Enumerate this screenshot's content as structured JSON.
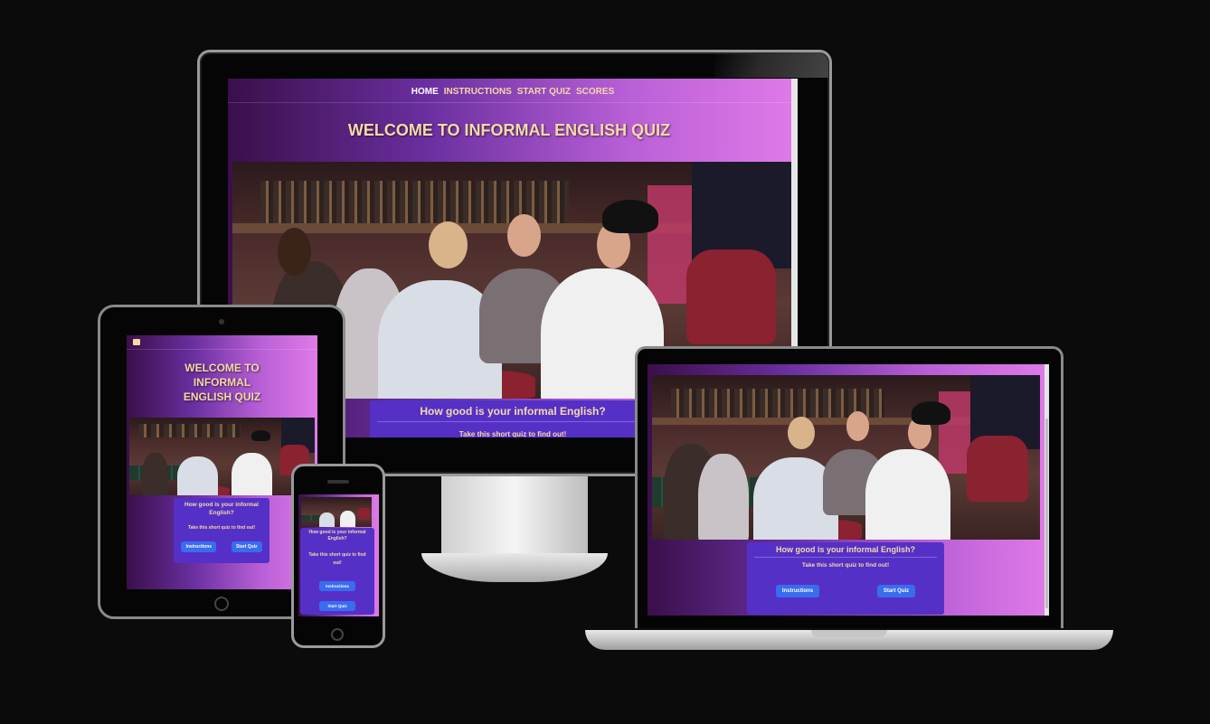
{
  "nav": {
    "home": "HOME",
    "instructions": "INSTRUCTIONS",
    "start_quiz": "START QUIZ",
    "scores": "SCORES"
  },
  "header": {
    "title": "WELCOME TO INFORMAL ENGLISH QUIZ",
    "title_tablet_line1": "WELCOME TO",
    "title_tablet_line2": "INFORMAL",
    "title_tablet_line3": "ENGLISH QUIZ"
  },
  "intro": {
    "question": "How good is your informal English?",
    "question_line1": "How good is your informal",
    "question_line2": "English?",
    "subtitle": "Take this short quiz to find out!",
    "subtitle_line1": "Take this short quiz to find",
    "subtitle_line2": "out!"
  },
  "buttons": {
    "instructions": "Instructions",
    "start_quiz": "Start Quiz"
  },
  "colors": {
    "page_background": "#0b0b0b",
    "gradient_start": "#3a0f4a",
    "gradient_end": "#e07ae8",
    "card": "#5530c7",
    "button": "#3a6cf0",
    "title_text": "#f6d9a6"
  }
}
